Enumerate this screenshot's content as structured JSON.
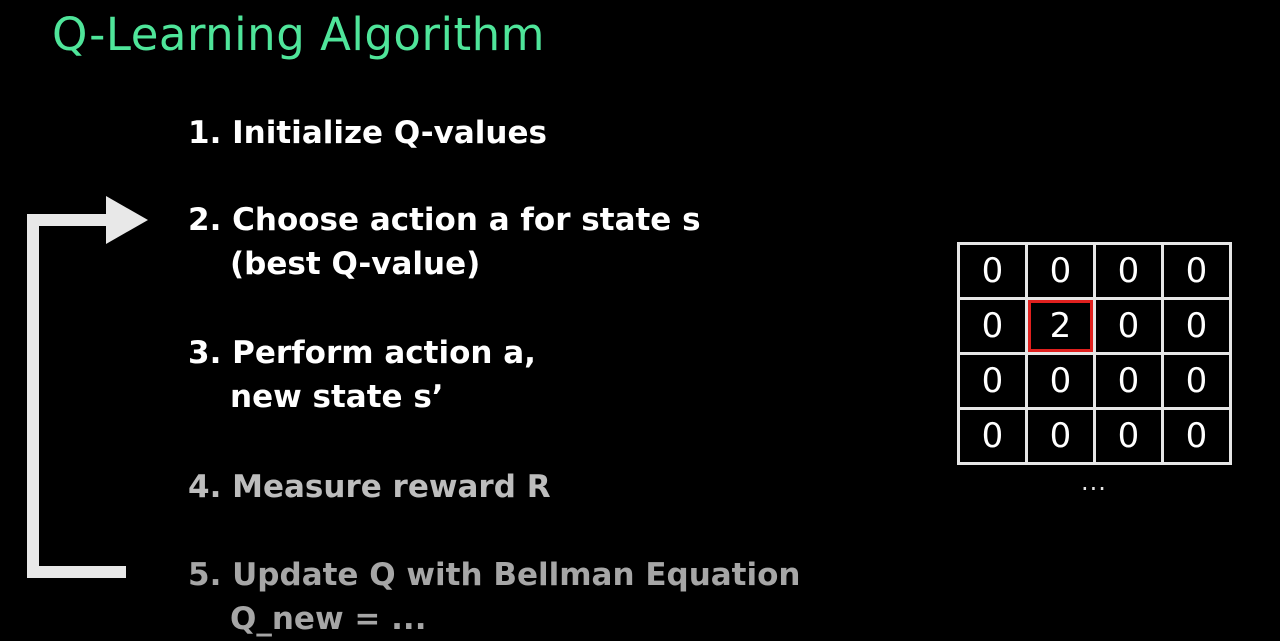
{
  "title": "Q-Learning Algorithm",
  "colors": {
    "title": "#4fe59a",
    "background": "#000000",
    "highlight": "#e0201e"
  },
  "steps": [
    {
      "text": "1. Initialize Q-values"
    },
    {
      "text": "2. Choose action a for state s",
      "text2": "(best Q-value)"
    },
    {
      "text": "3. Perform action a,",
      "text2": "new state s’"
    },
    {
      "text": "4. Measure reward R"
    },
    {
      "text": "5. Update Q with Bellman Equation",
      "text2": "Q_new = ..."
    }
  ],
  "loop_arrow": {
    "from_step": 5,
    "to_step": 2
  },
  "q_table": {
    "rows": [
      [
        "0",
        "0",
        "0",
        "0"
      ],
      [
        "0",
        "2",
        "0",
        "0"
      ],
      [
        "0",
        "0",
        "0",
        "0"
      ],
      [
        "0",
        "0",
        "0",
        "0"
      ]
    ],
    "highlighted_cell": {
      "row": 1,
      "col": 1
    },
    "continuation": "..."
  }
}
